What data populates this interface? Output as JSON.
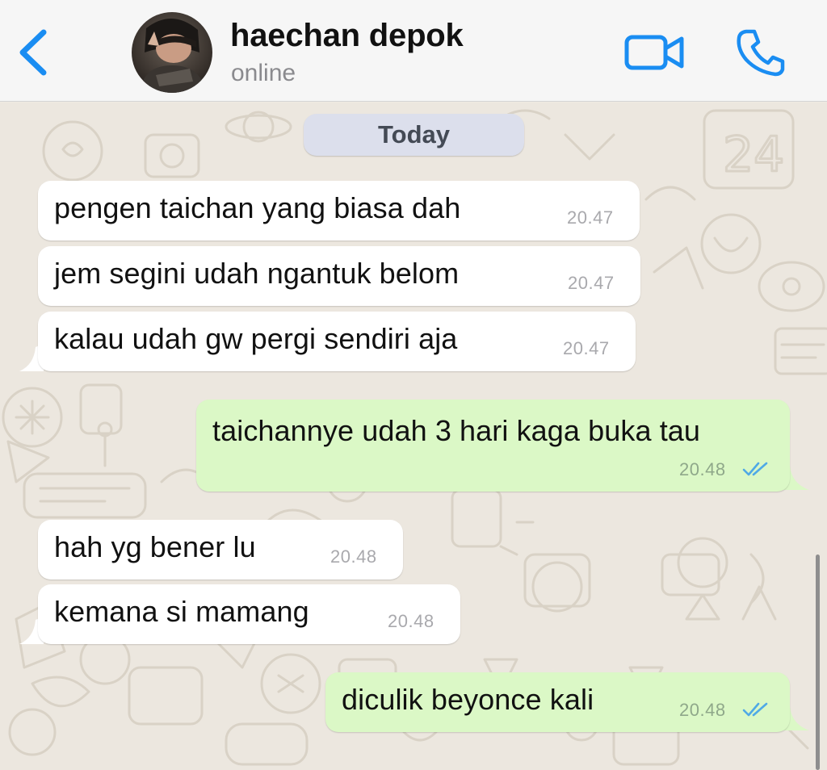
{
  "header": {
    "contact_name": "haechan depok",
    "status": "online",
    "back_icon": "chevron-left-icon",
    "video_icon": "video-camera-icon",
    "call_icon": "phone-icon",
    "accent_color": "#1a8df2"
  },
  "chat": {
    "date_label": "Today",
    "messages": [
      {
        "direction": "incoming",
        "text": "pengen taichan yang biasa dah",
        "time": "20.47"
      },
      {
        "direction": "incoming",
        "text": "jem segini udah ngantuk belom",
        "time": "20.47"
      },
      {
        "direction": "incoming",
        "text": "kalau udah gw pergi sendiri aja",
        "time": "20.47"
      },
      {
        "direction": "outgoing",
        "text": "taichannye udah 3 hari kaga buka tau",
        "time": "20.48",
        "status": "read"
      },
      {
        "direction": "incoming",
        "text": "hah yg bener lu",
        "time": "20.48"
      },
      {
        "direction": "incoming",
        "text": "kemana si mamang",
        "time": "20.48"
      },
      {
        "direction": "outgoing",
        "text": "diculik beyonce kali",
        "time": "20.48",
        "status": "read"
      }
    ]
  },
  "colors": {
    "incoming_bubble": "#ffffff",
    "outgoing_bubble": "#dbf8c6",
    "read_ticks": "#4fa9e6",
    "chat_background": "#ece7df"
  }
}
